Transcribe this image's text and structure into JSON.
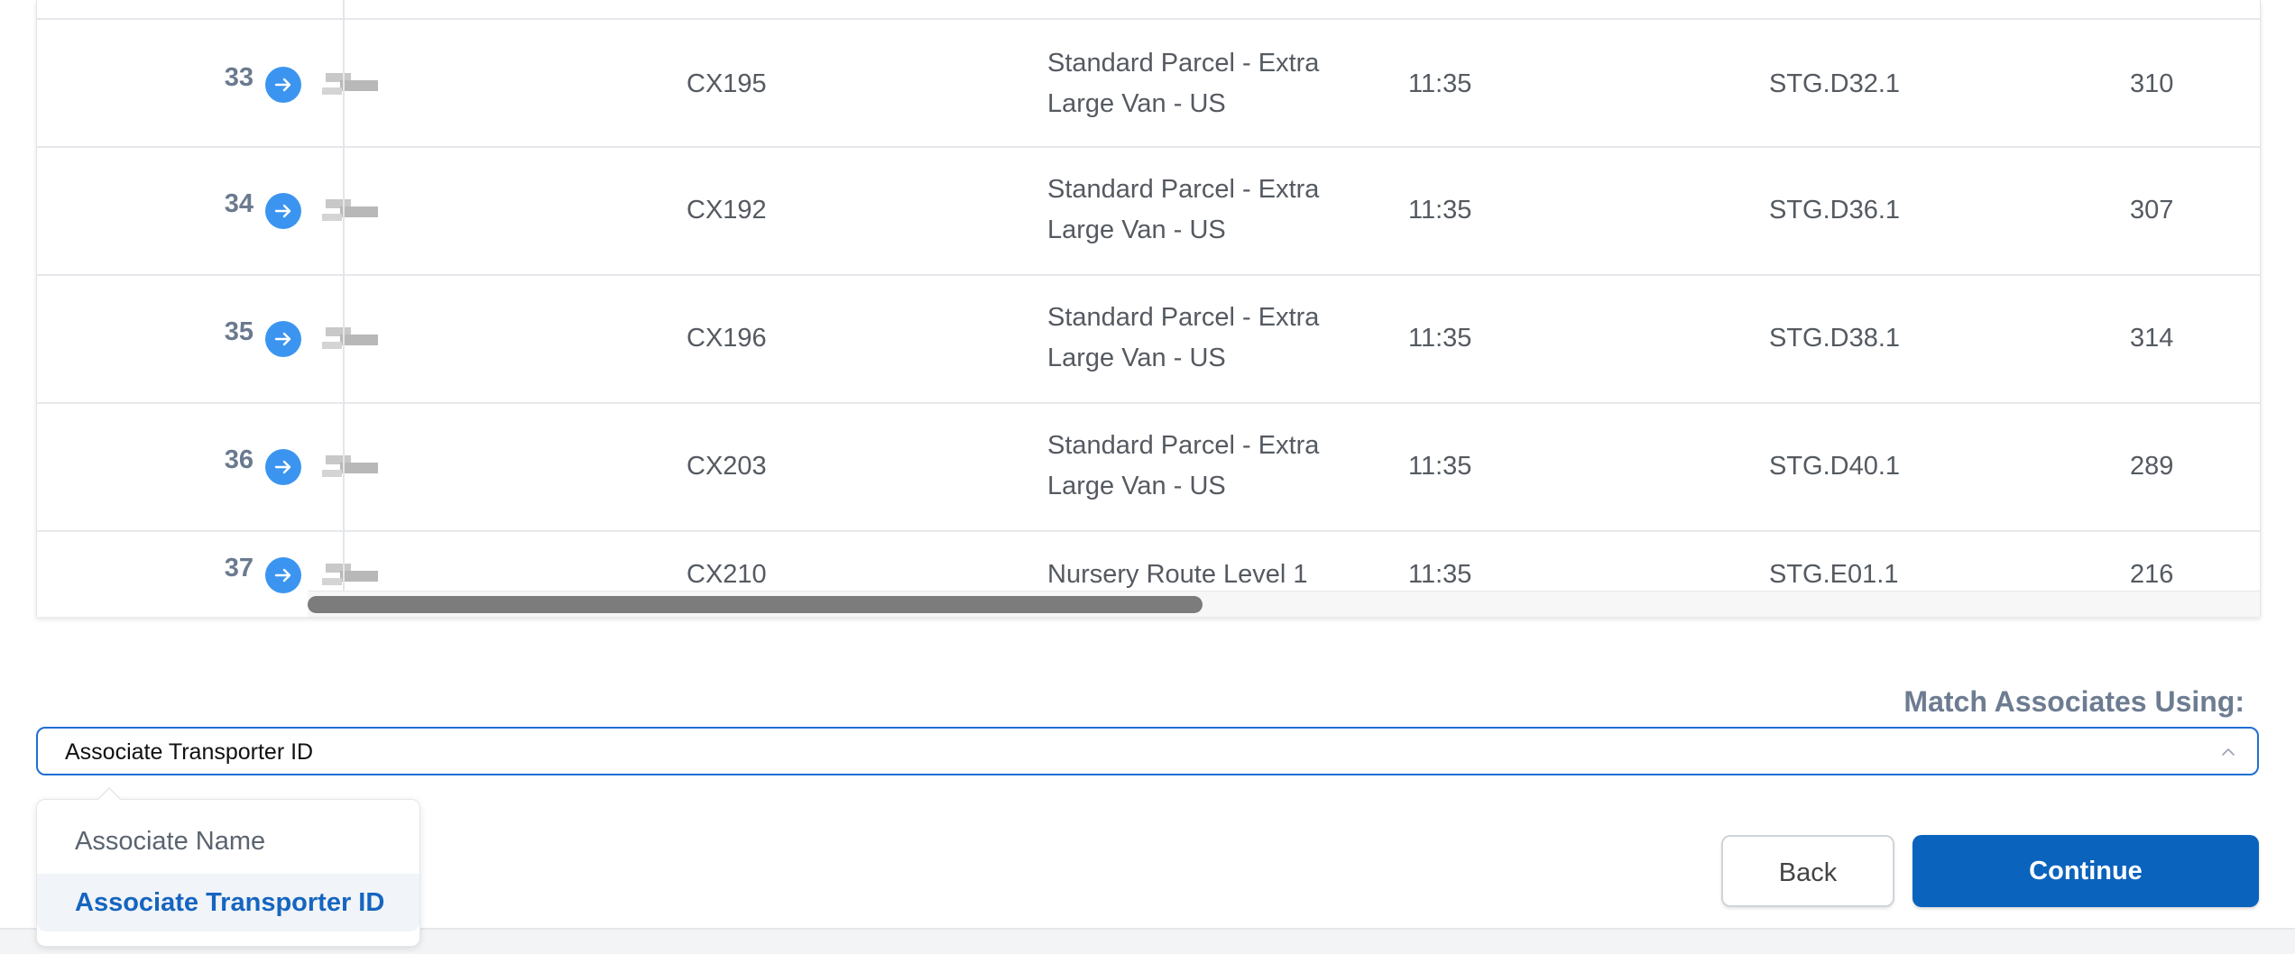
{
  "table": {
    "rows": [
      {
        "num": "33",
        "route": "CX195",
        "service_line1": "Standard Parcel - Extra",
        "service_line2": "Large Van - US",
        "time": "11:35",
        "staging": "STG.D32.1",
        "count": "310"
      },
      {
        "num": "34",
        "route": "CX192",
        "service_line1": "Standard Parcel - Extra",
        "service_line2": "Large Van - US",
        "time": "11:35",
        "staging": "STG.D36.1",
        "count": "307"
      },
      {
        "num": "35",
        "route": "CX196",
        "service_line1": "Standard Parcel - Extra",
        "service_line2": "Large Van - US",
        "time": "11:35",
        "staging": "STG.D38.1",
        "count": "314"
      },
      {
        "num": "36",
        "route": "CX203",
        "service_line1": "Standard Parcel - Extra",
        "service_line2": "Large Van - US",
        "time": "11:35",
        "staging": "STG.D40.1",
        "count": "289"
      },
      {
        "num": "37",
        "route": "CX210",
        "service_line1": "Nursery Route Level 1",
        "service_line2": "",
        "time": "11:35",
        "staging": "STG.E01.1",
        "count": "216"
      }
    ],
    "row_action_icon": "arrow-right-circle-icon"
  },
  "match": {
    "label": "Match Associates Using:",
    "selected": "Associate Transporter ID",
    "caret_icon": "chevron-up-icon",
    "options": [
      "Associate Name",
      "Associate Transporter ID"
    ]
  },
  "buttons": {
    "back": "Back",
    "continue": "Continue"
  },
  "colors": {
    "accent": "#0a63bd",
    "row_action": "#3b95f0",
    "selected_option": "#1565c0"
  }
}
